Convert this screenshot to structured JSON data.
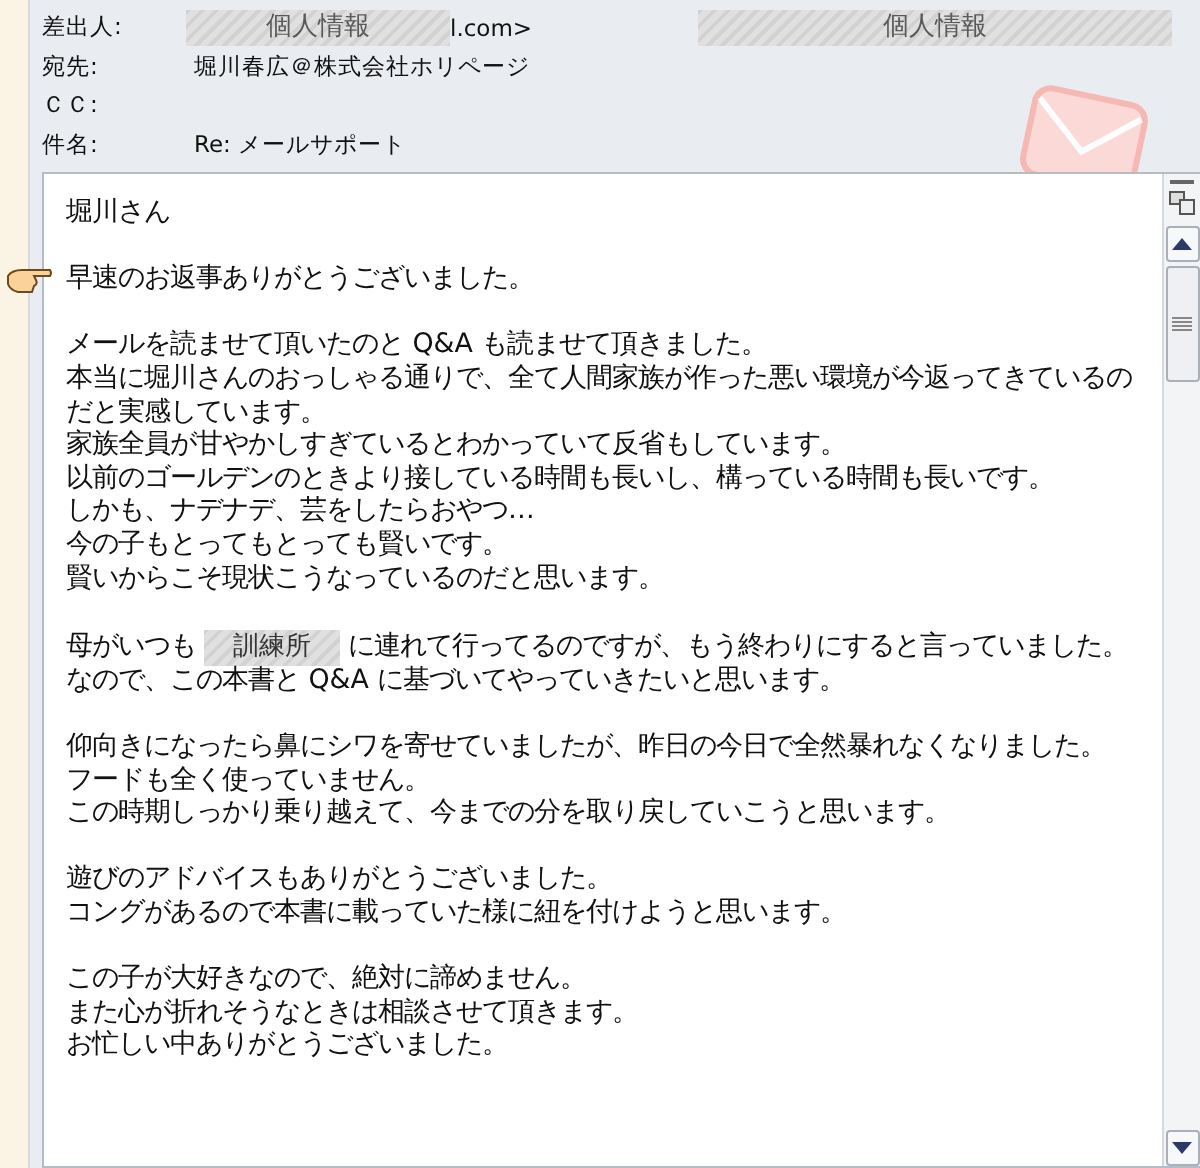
{
  "header": [
    {
      "label": "差出人:",
      "kind": "from",
      "redacted": "個人情報",
      "value": "l.com>",
      "redacted_right": "個人情報"
    },
    {
      "label": "宛先:",
      "kind": "plain",
      "value": "堀川春広＠株式会社ホリページ"
    },
    {
      "label": "ＣＣ:",
      "kind": "plain"
    },
    {
      "label": "件名:",
      "kind": "plain",
      "value": "Re: メールサポート"
    }
  ],
  "body": [
    {
      "lines": [
        {
          "kind": "text",
          "text": "堀川さん"
        }
      ]
    },
    {
      "lines": [
        {
          "kind": "text",
          "text": "早速のお返事ありがとうございました。"
        }
      ],
      "pointer": true
    },
    {
      "lines": [
        {
          "kind": "text",
          "text": "メールを読ませて頂いたのと Q&A も読ませて頂きました。"
        },
        {
          "kind": "text",
          "text": "本当に堀川さんのおっしゃる通りで、全て人間家族が作った悪い環境が今返ってきているのだと実感しています。"
        },
        {
          "kind": "text",
          "text": "家族全員が甘やかしすぎているとわかっていて反省もしています。"
        },
        {
          "kind": "text",
          "text": "以前のゴールデンのときより接している時間も長いし、構っている時間も長いです。"
        },
        {
          "kind": "text",
          "text": "しかも、ナデナデ、芸をしたらおやつ…"
        },
        {
          "kind": "text",
          "text": "今の子もとってもとっても賢いです。"
        },
        {
          "kind": "text",
          "text": "賢いからこそ現状こうなっているのだと思います。"
        }
      ]
    },
    {
      "lines": [
        {
          "kind": "redacted",
          "before": "母がいつも",
          "redacted": "訓練所",
          "after": "に連れて行ってるのですが、もう終わりにすると言っていました。"
        },
        {
          "kind": "text",
          "text": "なので、この本書と Q&A に基づいてやっていきたいと思います。"
        }
      ]
    },
    {
      "lines": [
        {
          "kind": "text",
          "text": "仰向きになったら鼻にシワを寄せていましたが、昨日の今日で全然暴れなくなりました。"
        },
        {
          "kind": "text",
          "text": "フードも全く使っていません。"
        },
        {
          "kind": "text",
          "text": "この時期しっかり乗り越えて、今までの分を取り戻していこうと思います。"
        }
      ]
    },
    {
      "lines": [
        {
          "kind": "text",
          "text": "遊びのアドバイスもありがとうございました。"
        },
        {
          "kind": "text",
          "text": "コングがあるので本書に載っていた様に紐を付けようと思います。"
        }
      ]
    },
    {
      "lines": [
        {
          "kind": "text",
          "text": "この子が大好きなので、絶対に諦めません。"
        },
        {
          "kind": "text",
          "text": "また心が折れそうなときは相談させて頂きます。"
        },
        {
          "kind": "text",
          "text": "お忙しい中ありがとうございました。"
        }
      ]
    }
  ]
}
